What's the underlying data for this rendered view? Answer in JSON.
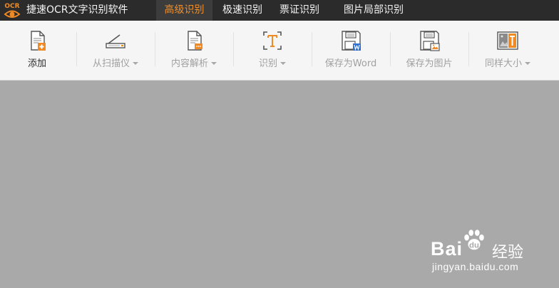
{
  "app": {
    "logo_text": "OCR",
    "title": "捷速OCR文字识别软件"
  },
  "tabs": [
    {
      "label": "高级识别",
      "active": true
    },
    {
      "label": "极速识别",
      "active": false
    },
    {
      "label": "票证识别",
      "active": false
    },
    {
      "label": "图片局部识别",
      "active": false
    }
  ],
  "toolbar": {
    "add": {
      "label": "添加",
      "icon": "add-file-icon"
    },
    "scanner": {
      "label": "从扫描仪",
      "icon": "scanner-icon"
    },
    "parse": {
      "label": "内容解析",
      "icon": "parse-document-icon"
    },
    "recognize": {
      "label": "识别",
      "icon": "text-recognize-icon"
    },
    "save_word": {
      "label": "保存为Word",
      "icon": "save-word-icon"
    },
    "save_image": {
      "label": "保存为图片",
      "icon": "save-image-icon"
    },
    "same_size": {
      "label": "同样大小",
      "icon": "same-size-icon"
    }
  },
  "watermark": {
    "brand": "Bai",
    "brand2": "du",
    "cn": "经验",
    "url": "jingyan.baidu.com"
  },
  "colors": {
    "accent": "#ef8f2b",
    "topbar": "#2b2b2b",
    "workspace": "#a9a9a9"
  }
}
